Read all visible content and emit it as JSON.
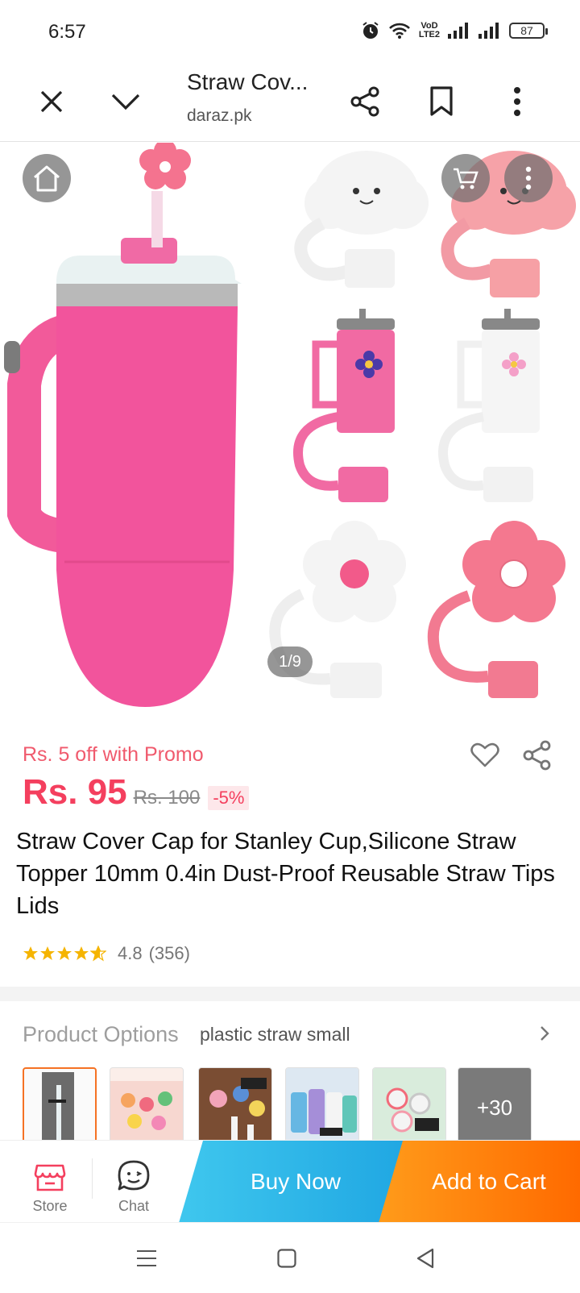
{
  "status_bar": {
    "time": "6:57",
    "volte_top": "VoD",
    "volte_bottom": "LTE2",
    "battery": "87"
  },
  "browser": {
    "title": "Straw Cov...",
    "domain": "daraz.pk"
  },
  "gallery": {
    "counter": "1/9"
  },
  "product": {
    "promo": "Rs. 5 off with Promo",
    "price": "Rs. 95",
    "old_price": "Rs. 100",
    "discount": "-5%",
    "title": "Straw Cover Cap for Stanley Cup,Silicone Straw Topper 10mm 0.4in Dust-Proof Reusable Straw Tips Lids",
    "rating": "4.8",
    "reviews": "(356)"
  },
  "options": {
    "label": "Product Options",
    "value": "plastic straw small",
    "more": "+30"
  },
  "actions": {
    "store": "Store",
    "chat": "Chat",
    "buy_now": "Buy Now",
    "add_to_cart": "Add to Cart"
  },
  "colors": {
    "accent": "#f43f5e",
    "buy_now": "#1fa6e2",
    "add_to_cart": "#ff6a00",
    "star": "#f5b400"
  }
}
